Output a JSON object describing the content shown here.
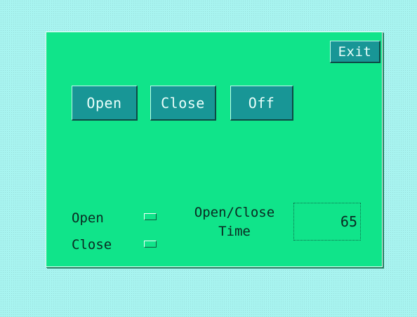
{
  "panel": {
    "exit_label": "Exit",
    "buttons": {
      "open_label": "Open",
      "close_label": "Close",
      "off_label": "Off"
    },
    "status": {
      "open_label": "Open",
      "close_label": "Close",
      "open_indicator_on": false,
      "close_indicator_on": false
    },
    "time": {
      "label_line1": "Open/Close",
      "label_line2": "Time",
      "value": "65"
    }
  },
  "colors": {
    "background": "#a8f4f0",
    "panel": "#10e48a",
    "button": "#1aa0a0",
    "button_text": "#eafffb",
    "text": "#0a2a22"
  }
}
